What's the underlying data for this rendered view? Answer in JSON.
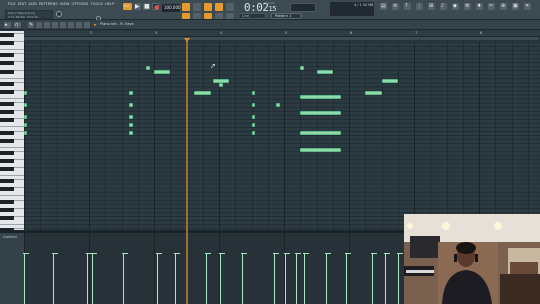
{
  "menu": [
    "FILE",
    "EDIT",
    "ADD",
    "PATTERNS",
    "VIEW",
    "OPTIONS",
    "TOOLS",
    "HELP"
  ],
  "hint": [
    "Piano Melodies Pg",
    "3:11:66 Bar 3:01:00"
  ],
  "toolbar": {
    "mode_label": "PAT",
    "tempo": "100.000",
    "time": "0:02",
    "time_ms": "15",
    "time_sub": "M:S:CS",
    "line_label": "Line",
    "pattern_label": "Pattern 1",
    "cpu_label": "4 / 1 04 MB"
  },
  "roll": {
    "title": "Piano roll - FL Keys"
  },
  "control": {
    "label": "Control"
  },
  "bars": [
    "2",
    "3",
    "4",
    "5",
    "6",
    "7",
    "8"
  ],
  "colors": {
    "note": "#8fdcaa",
    "accent": "#e79a2b",
    "grid": "#2c3a42"
  },
  "icons": [
    "play-icon",
    "stop-icon",
    "record-icon",
    "snap-icon",
    "pencil-icon",
    "brush-icon",
    "mute-icon",
    "select-icon",
    "zoom-icon",
    "help-icon",
    "mouse-cursor-icon"
  ],
  "notes": [
    {
      "start": 1.88,
      "len": 0.06,
      "row": 6
    },
    {
      "start": 2.0,
      "len": 0.25,
      "row": 7
    },
    {
      "start": 0.0,
      "len": 0.04,
      "row": 12
    },
    {
      "start": 1.62,
      "len": 0.06,
      "row": 12
    },
    {
      "start": 2.9,
      "len": 0.25,
      "row": 9
    },
    {
      "start": 2.62,
      "len": 0.25,
      "row": 12
    },
    {
      "start": 3.0,
      "len": 0.06,
      "row": 10
    },
    {
      "start": 3.5,
      "len": 0.06,
      "row": 12
    },
    {
      "start": 0.0,
      "len": 0.04,
      "row": 15
    },
    {
      "start": 1.62,
      "len": 0.06,
      "row": 15
    },
    {
      "start": 3.5,
      "len": 0.06,
      "row": 15
    },
    {
      "start": 3.88,
      "len": 0.06,
      "row": 15
    },
    {
      "start": 0.0,
      "len": 0.04,
      "row": 18
    },
    {
      "start": 1.62,
      "len": 0.06,
      "row": 18
    },
    {
      "start": 3.5,
      "len": 0.06,
      "row": 18
    },
    {
      "start": 0.0,
      "len": 0.04,
      "row": 20
    },
    {
      "start": 1.62,
      "len": 0.06,
      "row": 20
    },
    {
      "start": 3.5,
      "len": 0.06,
      "row": 20
    },
    {
      "start": 0.0,
      "len": 0.04,
      "row": 22
    },
    {
      "start": 1.62,
      "len": 0.06,
      "row": 22
    },
    {
      "start": 3.5,
      "len": 0.06,
      "row": 22
    },
    {
      "start": 4.25,
      "len": 0.06,
      "row": 6
    },
    {
      "start": 4.5,
      "len": 0.25,
      "row": 7
    },
    {
      "start": 5.5,
      "len": 0.25,
      "row": 9
    },
    {
      "start": 5.25,
      "len": 0.25,
      "row": 12
    },
    {
      "start": 4.25,
      "len": 0.62,
      "row": 13
    },
    {
      "start": 4.25,
      "len": 0.62,
      "row": 17
    },
    {
      "start": 4.25,
      "len": 0.62,
      "row": 22
    },
    {
      "start": 4.25,
      "len": 0.62,
      "row": 26
    }
  ],
  "velocities": [
    {
      "pos": 0.0,
      "h": 0.72
    },
    {
      "pos": 0.45,
      "h": 0.72
    },
    {
      "pos": 0.97,
      "h": 0.72
    },
    {
      "pos": 1.05,
      "h": 0.72
    },
    {
      "pos": 1.53,
      "h": 0.72
    },
    {
      "pos": 2.05,
      "h": 0.72
    },
    {
      "pos": 2.32,
      "h": 0.72
    },
    {
      "pos": 2.8,
      "h": 0.72
    },
    {
      "pos": 3.01,
      "h": 0.72
    },
    {
      "pos": 3.35,
      "h": 0.72
    },
    {
      "pos": 3.85,
      "h": 0.72
    },
    {
      "pos": 4.02,
      "h": 0.72
    },
    {
      "pos": 4.18,
      "h": 0.72
    },
    {
      "pos": 4.3,
      "h": 0.72
    },
    {
      "pos": 4.65,
      "h": 0.72
    },
    {
      "pos": 4.96,
      "h": 0.72
    },
    {
      "pos": 5.35,
      "h": 0.72
    },
    {
      "pos": 5.55,
      "h": 0.72
    },
    {
      "pos": 5.75,
      "h": 0.72
    },
    {
      "pos": 5.92,
      "h": 0.72
    }
  ]
}
